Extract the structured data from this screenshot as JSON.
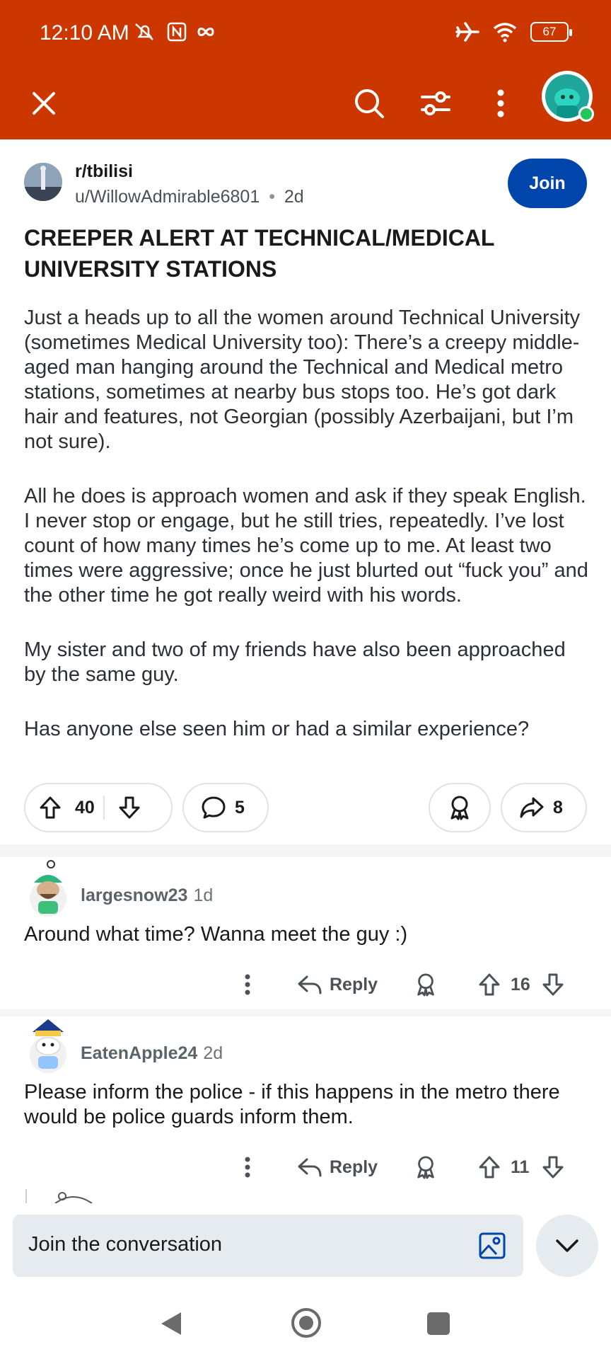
{
  "status_bar": {
    "time": "12:10 AM",
    "battery": "67"
  },
  "toolbar": {
    "close_icon": "close-icon",
    "search_icon": "search-icon",
    "filter_icon": "filter-icon",
    "more_icon": "more-vertical-icon",
    "avatar": "user-avatar"
  },
  "post": {
    "subreddit": "r/tbilisi",
    "author": "u/WillowAdmirable6801",
    "separator": "•",
    "age": "2d",
    "join_label": "Join",
    "title": "CREEPER ALERT AT TECHNICAL/MEDICAL UNIVERSITY STATIONS",
    "paragraphs": [
      "Just a heads up to all the women around Technical University (sometimes Medical University too): There’s a creepy middle-aged man hanging around the Technical and Medical metro stations, sometimes at nearby bus stops too. He’s got dark hair and features, not Georgian (possibly Azerbaijani, but I’m not sure).",
      "All he does is approach women and ask if they speak English. I never stop or engage, but he still tries, repeatedly. I’ve lost count of how many times he’s come up to me. At least two times were aggressive; once he just blurted out “fuck you” and the other time he got really weird with his words.",
      "My sister and two of my friends have also been approached by the same guy.",
      "Has anyone else seen him or had a similar experience?"
    ],
    "votes": "40",
    "comments": "5",
    "shares": "8"
  },
  "comments": [
    {
      "username": "largesnow23",
      "age": "1d",
      "text": "Around what time? Wanna meet the guy :)",
      "reply_label": "Reply",
      "votes": "16"
    },
    {
      "username": "EatenApple24",
      "age": "2d",
      "text": "Please inform the police - if this happens in the metro there would be police guards inform them.",
      "reply_label": "Reply",
      "votes": "11"
    }
  ],
  "composer": {
    "placeholder": "Join the conversation"
  },
  "colors": {
    "header": "#cc3700",
    "join_button": "#0045ac",
    "online": "#22c55e"
  }
}
